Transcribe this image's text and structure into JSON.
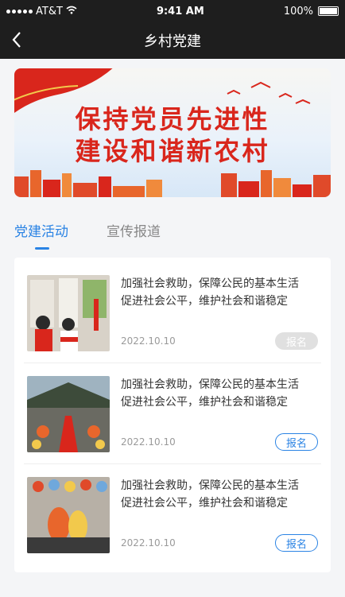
{
  "status_bar": {
    "carrier": "AT&T",
    "time": "9:41 AM",
    "battery": "100%"
  },
  "nav": {
    "title": "乡村党建"
  },
  "banner": {
    "line1": "保持党员先进性",
    "line2": "建设和谐新农村"
  },
  "tabs": [
    {
      "label": "党建活动",
      "active": true
    },
    {
      "label": "宣传报道",
      "active": false
    }
  ],
  "items": [
    {
      "line1": "加强社会救助，保障公民的基本生活",
      "line2": "促进社会公平，维护社会和谐稳定",
      "date": "2022.10.10",
      "button": "报名",
      "button_state": "disabled"
    },
    {
      "line1": "加强社会救助，保障公民的基本生活",
      "line2": "促进社会公平，维护社会和谐稳定",
      "date": "2022.10.10",
      "button": "报名",
      "button_state": "enabled"
    },
    {
      "line1": "加强社会救助，保障公民的基本生活",
      "line2": "促进社会公平，维护社会和谐稳定",
      "date": "2022.10.10",
      "button": "报名",
      "button_state": "enabled"
    }
  ],
  "colors": {
    "accent": "#2a83e4",
    "banner_text": "#d9261c",
    "header_bg": "#1e1e1e"
  }
}
